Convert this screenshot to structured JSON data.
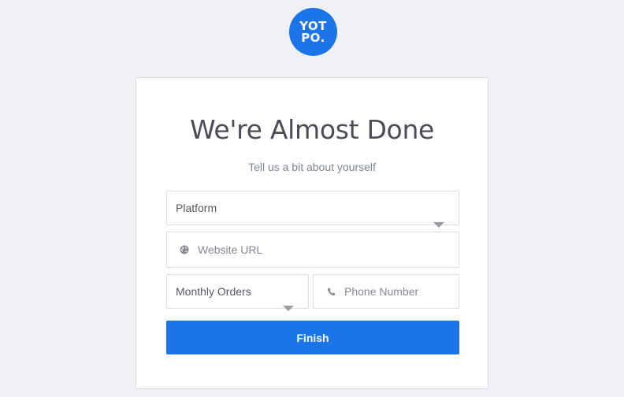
{
  "logo": {
    "line1": "YOT",
    "line2": "PO.",
    "color": "#1c74e9"
  },
  "card": {
    "title": "We're Almost Done",
    "subtitle": "Tell us a bit about yourself"
  },
  "form": {
    "platform": {
      "value": "Platform",
      "icon": "chevron-down-icon"
    },
    "website": {
      "placeholder": "Website URL",
      "icon": "globe-icon"
    },
    "monthly_orders": {
      "value": "Monthly Orders",
      "icon": "chevron-down-icon"
    },
    "phone": {
      "placeholder": "Phone Number",
      "icon": "phone-icon"
    },
    "submit_label": "Finish"
  },
  "colors": {
    "accent": "#1c74e9",
    "background": "#f0f1f4"
  }
}
